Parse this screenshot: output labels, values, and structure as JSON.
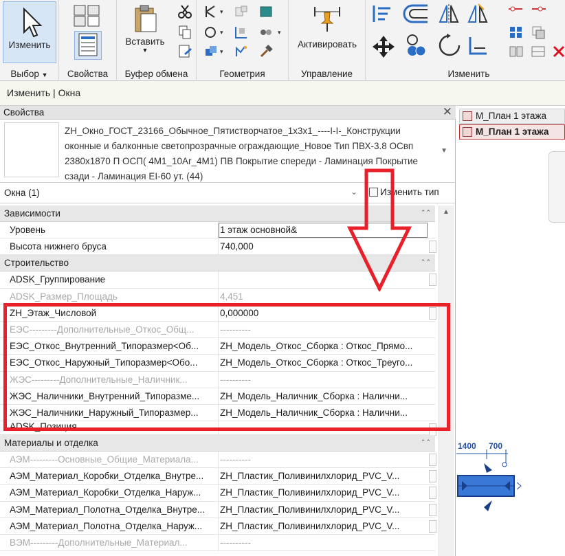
{
  "ribbon": {
    "modify_label": "Изменить",
    "select_label": "Выбор",
    "properties_label": "Свойства",
    "paste_label": "Вставить",
    "clipboard_label": "Буфер обмена",
    "geometry_label": "Геометрия",
    "activate_label": "Активировать",
    "manage_label": "Управление",
    "modify_panel_label": "Изменить",
    "accent_color": "#2b6cc4"
  },
  "context_bar": {
    "text": "Изменить | Окна"
  },
  "properties": {
    "title": "Свойства",
    "type_name": "ZH_Окно_ГОСТ_23166_Обычное_Пятистворчатое_1х3х1_----I-I-_Конструкции оконные и балконные светопрозрачные ограждающие_Новое Тип ПВХ-3.8 ОСвп 2380х1870 П ОСП( 4М1_10Ar_4М1) ПВ Покрытие спереди - Ламинация Покрытие сзади - Ламинация EI-60 ут. (44)",
    "instance_filter": "Окна (1)",
    "edit_type_label": "Изменить тип",
    "groups": [
      {
        "name": "Зависимости",
        "rows": [
          {
            "key": "Уровень",
            "value": "1 этаж основной&",
            "dim": false
          },
          {
            "key": "Высота нижнего бруса",
            "value": "740,000",
            "dim": false
          }
        ]
      },
      {
        "name": "Строительство",
        "rows": [
          {
            "key": "ADSK_Группирование",
            "value": "",
            "dim": false
          },
          {
            "key": "ADSK_Размер_Площадь",
            "value": "4,451",
            "dim": true
          },
          {
            "key": "ZH_Этаж_Числовой",
            "value": "0,000000",
            "dim": false
          },
          {
            "key": "ЕЭС---------Дополнительные_Откос_Общ...",
            "value": "----------",
            "dim": true
          },
          {
            "key": "ЕЭС_Откос_Внутренний_Типоразмер<Об...",
            "value": "ZH_Модель_Откос_Сборка : Откос_Прямо...",
            "dim": false
          },
          {
            "key": "ЕЭС_Откос_Наружный_Типоразмер<Обо...",
            "value": "ZH_Модель_Откос_Сборка : Откос_Треуго...",
            "dim": false
          },
          {
            "key": "ЖЭС---------Дополнительные_Наличник...",
            "value": "----------",
            "dim": true
          },
          {
            "key": "ЖЭС_Наличники_Внутренний_Типоразме...",
            "value": "ZH_Модель_Наличник_Сборка : Налични...",
            "dim": false
          },
          {
            "key": "ЖЭС_Наличники_Наружный_Типоразмер...",
            "value": "ZH_Модель_Наличник_Сборка : Налични...",
            "dim": false
          },
          {
            "key": "ADSK_Позиция",
            "value": "",
            "dim": false
          }
        ]
      },
      {
        "name": "Материалы и отделка",
        "rows": [
          {
            "key": "АЭМ---------Основные_Общие_Материала...",
            "value": "----------",
            "dim": true
          },
          {
            "key": "АЭМ_Материал_Коробки_Отделка_Внутре...",
            "value": "ZH_Пластик_Поливинилхлорид_PVC_V...",
            "dim": false
          },
          {
            "key": "АЭМ_Материал_Коробки_Отделка_Наруж...",
            "value": "ZH_Пластик_Поливинилхлорид_PVC_V...",
            "dim": false
          },
          {
            "key": "АЭМ_Материал_Полотна_Отделка_Внутре...",
            "value": "ZH_Пластик_Поливинилхлорид_PVC_V...",
            "dim": false
          },
          {
            "key": "АЭМ_Материал_Полотна_Отделка_Наруж...",
            "value": "ZH_Пластик_Поливинилхлорид_PVC_V...",
            "dim": false
          },
          {
            "key": "ВЭМ---------Дополнительные_Материал...",
            "value": "----------",
            "dim": true
          }
        ]
      }
    ]
  },
  "view": {
    "tabs": [
      "М_План 1 этажа",
      "М_План 1 этажа"
    ],
    "dimensions": [
      "1400",
      "700"
    ]
  },
  "annotation_color": "#e8202a"
}
